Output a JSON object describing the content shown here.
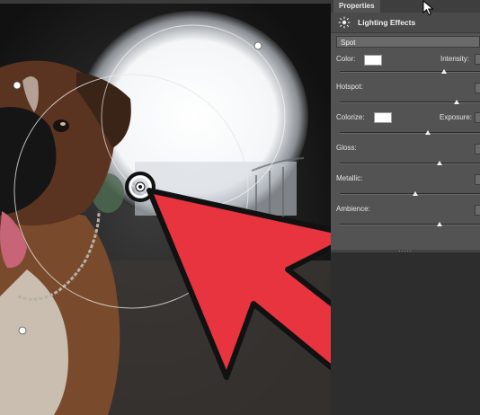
{
  "panel": {
    "tab_label": "Properties",
    "title": "Lighting Effects",
    "light_type": "Spot",
    "color_label": "Color:",
    "intensity_label": "Intensity:",
    "hotspot_label": "Hotspot:",
    "colorize_label": "Colorize:",
    "exposure_label": "Exposure:",
    "gloss_label": "Gloss:",
    "metallic_label": "Metallic:",
    "ambience_label": "Ambience:"
  },
  "colors": {
    "panel_bg": "#535353",
    "arrow_red": "#e8343f",
    "swatch_white": "#ffffff"
  },
  "icons": [
    "lighting-effects-icon",
    "mouse-pointer-icon",
    "light-center-handle-icon"
  ]
}
